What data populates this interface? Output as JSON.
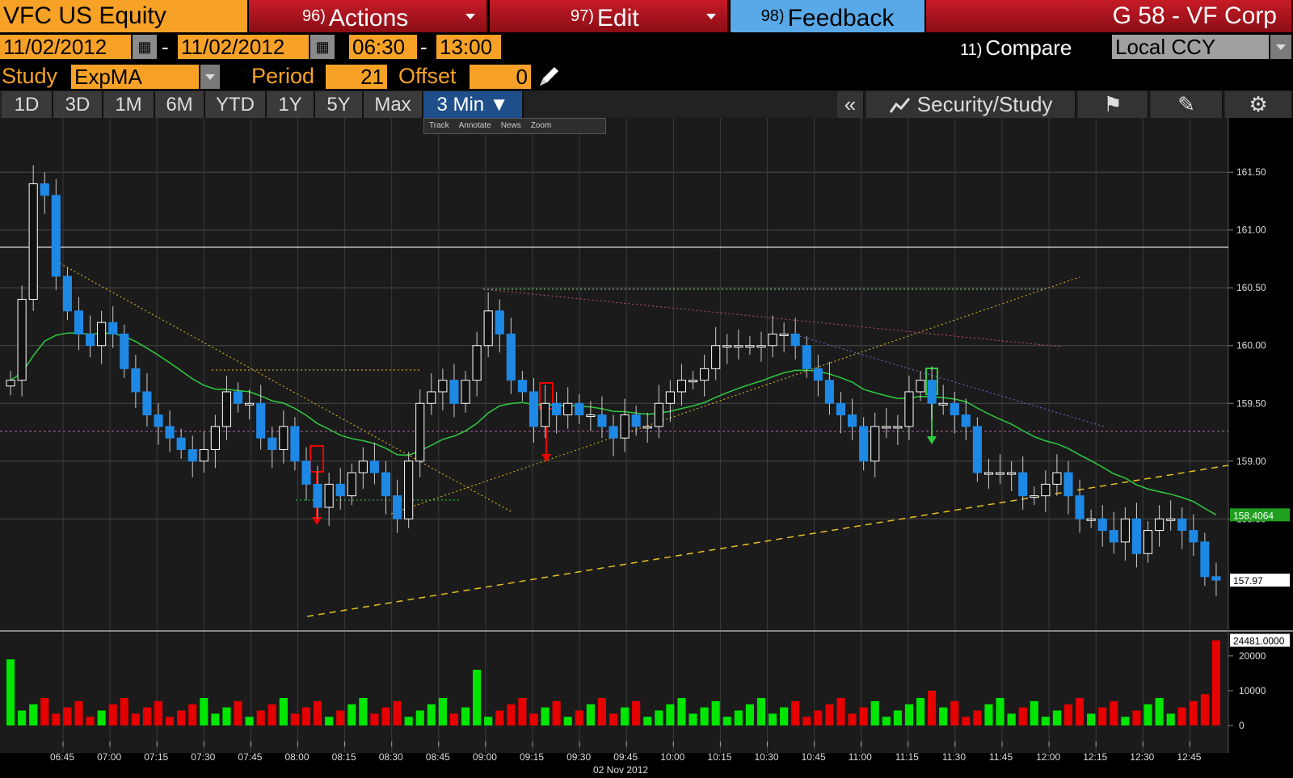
{
  "header": {
    "ticker": "VFC US Equity",
    "actions": {
      "num": "96)",
      "label": "Actions"
    },
    "edit": {
      "num": "97)",
      "label": "Edit"
    },
    "feedback": {
      "num": "98)",
      "label": "Feedback"
    },
    "security_name": "G 58 - VF Corp"
  },
  "range": {
    "start_date": "11/02/2012",
    "separator": "-",
    "end_date": "11/02/2012",
    "start_time": "06:30",
    "end_time": "13:00",
    "compare": {
      "num": "11)",
      "label": "Compare"
    },
    "currency": "Local CCY"
  },
  "study": {
    "label": "Study",
    "value": "ExpMA",
    "period_label": "Period",
    "period_value": "21",
    "offset_label": "Offset",
    "offset_value": "0"
  },
  "tabs": [
    "1D",
    "3D",
    "1M",
    "6M",
    "YTD",
    "1Y",
    "5Y",
    "Max",
    "3 Min ▼"
  ],
  "right_tools": {
    "collapse": "«",
    "security_study": "Security/Study"
  },
  "mini_toolbar": [
    "Track",
    "Annotate",
    "News",
    "Zoom"
  ],
  "colors": {
    "up": "#ffffff",
    "down": "#1e88e5",
    "ema": "#2ecc40",
    "vol_up": "#00e600",
    "vol_down": "#e60000",
    "accent": "#f7a226"
  },
  "chart_data": {
    "type": "candlestick",
    "date_label": "02 Nov 2012",
    "x_ticks": [
      "06:45",
      "07:00",
      "07:15",
      "07:30",
      "07:45",
      "08:00",
      "08:15",
      "08:30",
      "08:45",
      "09:00",
      "09:15",
      "09:30",
      "09:45",
      "10:00",
      "10:15",
      "10:30",
      "10:45",
      "11:00",
      "11:15",
      "11:30",
      "11:45",
      "12:00",
      "12:15",
      "12:30",
      "12:45"
    ],
    "y_ticks": [
      "161.50",
      "161.00",
      "160.50",
      "160.00",
      "159.50",
      "159.00",
      "158.50"
    ],
    "ylim": [
      157.6,
      161.9
    ],
    "ema_label": "158.4064",
    "last_price_label": "157.97",
    "volume_max_label": "24481.0000",
    "volume_ticks": [
      "20000",
      "10000",
      "0"
    ],
    "volume_ylim": [
      0,
      26000
    ],
    "closes": [
      159.7,
      160.4,
      161.4,
      161.3,
      160.6,
      160.3,
      160.1,
      160.0,
      160.2,
      160.1,
      159.8,
      159.6,
      159.4,
      159.3,
      159.2,
      159.1,
      159.0,
      159.1,
      159.3,
      159.6,
      159.5,
      159.5,
      159.2,
      159.1,
      159.3,
      159.0,
      158.8,
      158.6,
      158.8,
      158.7,
      158.9,
      159.0,
      158.9,
      158.7,
      158.5,
      159.0,
      159.5,
      159.6,
      159.7,
      159.5,
      159.7,
      160.0,
      160.3,
      160.1,
      159.7,
      159.6,
      159.3,
      159.5,
      159.4,
      159.5,
      159.4,
      159.4,
      159.3,
      159.2,
      159.4,
      159.3,
      159.3,
      159.5,
      159.6,
      159.7,
      159.7,
      159.8,
      160.0,
      160.0,
      160.0,
      160.0,
      160.0,
      160.1,
      160.1,
      160.0,
      159.8,
      159.7,
      159.5,
      159.4,
      159.3,
      159.0,
      159.3,
      159.3,
      159.3,
      159.6,
      159.7,
      159.5,
      159.5,
      159.4,
      159.3,
      158.9,
      158.9,
      158.9,
      158.9,
      158.7,
      158.7,
      158.8,
      158.9,
      158.7,
      158.5,
      158.5,
      158.4,
      158.3,
      158.5,
      158.2,
      158.4,
      158.5,
      158.5,
      158.4,
      158.3,
      158.0,
      157.97
    ]
  }
}
